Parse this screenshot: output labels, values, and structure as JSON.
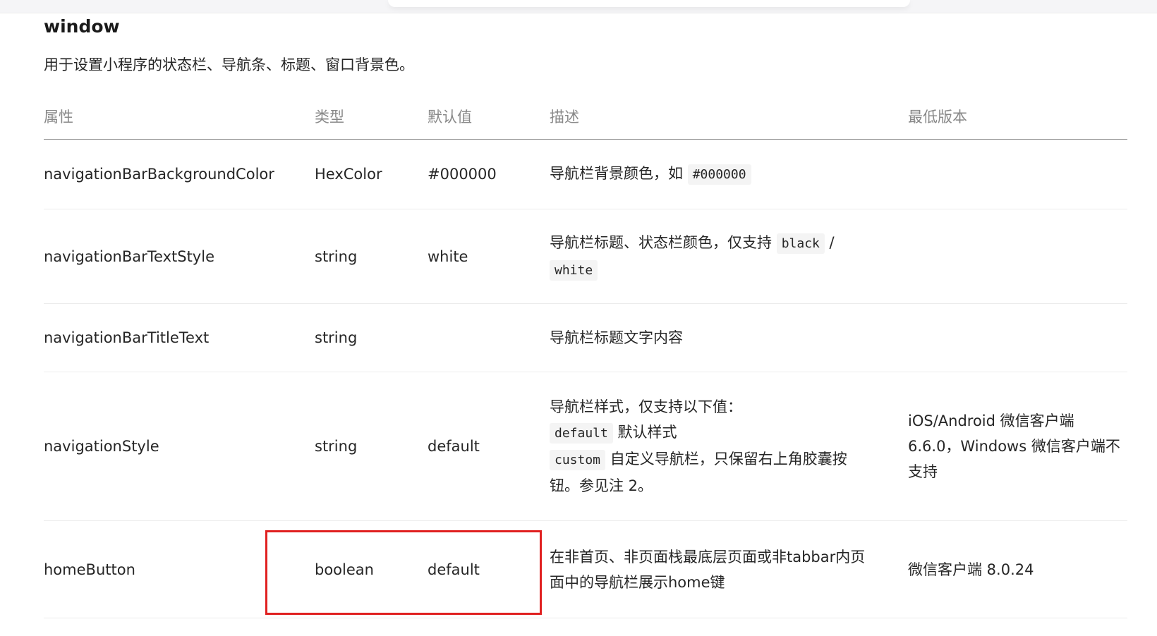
{
  "section": {
    "title": "window",
    "description": "用于设置小程序的状态栏、导航条、标题、窗口背景色。"
  },
  "table": {
    "headers": {
      "property": "属性",
      "type": "类型",
      "default": "默认值",
      "description": "描述",
      "min_version": "最低版本"
    },
    "rows": [
      {
        "property": "navigationBarBackgroundColor",
        "type": "HexColor",
        "default": "#000000",
        "desc_text_1": "导航栏背景颜色，如",
        "desc_code_1": "#000000",
        "min_version": ""
      },
      {
        "property": "navigationBarTextStyle",
        "type": "string",
        "default": "white",
        "desc_text_1": "导航栏标题、状态栏颜色，仅支持",
        "desc_code_1": "black",
        "desc_sep": " / ",
        "desc_code_2": "white",
        "min_version": ""
      },
      {
        "property": "navigationBarTitleText",
        "type": "string",
        "default": "",
        "desc_text_1": "导航栏标题文字内容",
        "min_version": ""
      },
      {
        "property": "navigationStyle",
        "type": "string",
        "default": "default",
        "desc_text_1": "导航栏样式，仅支持以下值：",
        "desc_code_1": "default",
        "desc_text_2": " 默认样式",
        "desc_code_2": "custom",
        "desc_text_3": " 自定义导航栏，只保留右上角胶囊按钮。参见注 2。",
        "min_version": "iOS/Android 微信客户端 6.6.0，Windows 微信客户端不支持"
      },
      {
        "property": "homeButton",
        "type": "boolean",
        "default": "default",
        "desc_text_1": "在非首页、非页面栈最底层页面或非tabbar内页面中的导航栏展示home键",
        "min_version": "微信客户端 8.0.24"
      }
    ]
  },
  "colors": {
    "highlight_border": "#e02020",
    "header_text": "#888888",
    "code_bg": "#f4f4f4"
  }
}
